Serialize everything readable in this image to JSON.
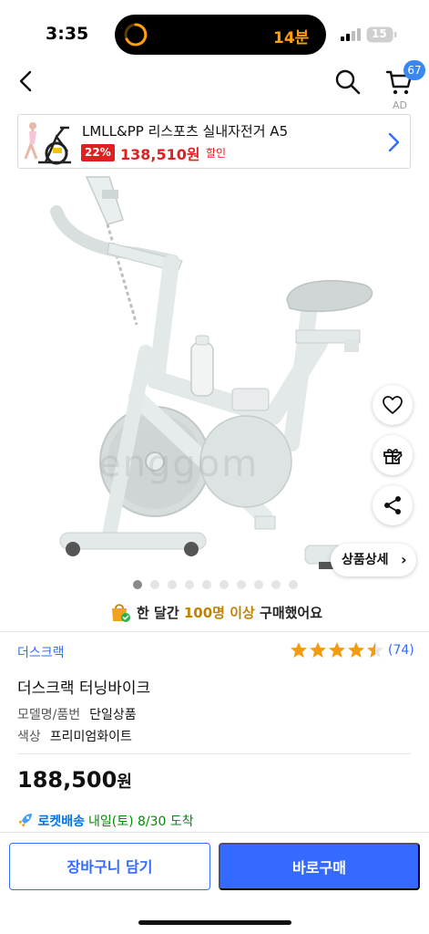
{
  "status_bar": {
    "time": "3:35",
    "timer": "14분",
    "battery": "15"
  },
  "nav": {
    "cart_count": "67",
    "ad_label": "AD"
  },
  "ad_banner": {
    "title": "LMLL&PP 리스포츠 실내자전거 A5",
    "discount": "22%",
    "price": "138,510원",
    "sale_label": "할인"
  },
  "product_image": {
    "watermark": "enggom",
    "detail_button": "상품상세",
    "slide_count": 10,
    "active_slide": 1
  },
  "purchase_note": {
    "prefix": "한 달간 ",
    "highlight": "100명 이상",
    "suffix": " 구매했어요"
  },
  "product": {
    "brand": "더스크랙",
    "rating": 4.5,
    "review_count": "(74)",
    "name": "더스크랙 터닝바이크",
    "specs": [
      {
        "label": "모델명/품번",
        "value": "단일상품"
      },
      {
        "label": "색상",
        "value": "프리미엄화이트"
      }
    ],
    "price": "188,500",
    "price_unit": "원"
  },
  "delivery": {
    "label": "로켓배송",
    "date": "내일(토) 8/30 도착"
  },
  "bottom_bar": {
    "cart_button": "장바구니 담기",
    "buy_button": "바로구매"
  },
  "colors": {
    "accent": "#346aff",
    "sale": "#e02020",
    "star": "#f39c12",
    "delivery_date": "#008c00"
  }
}
